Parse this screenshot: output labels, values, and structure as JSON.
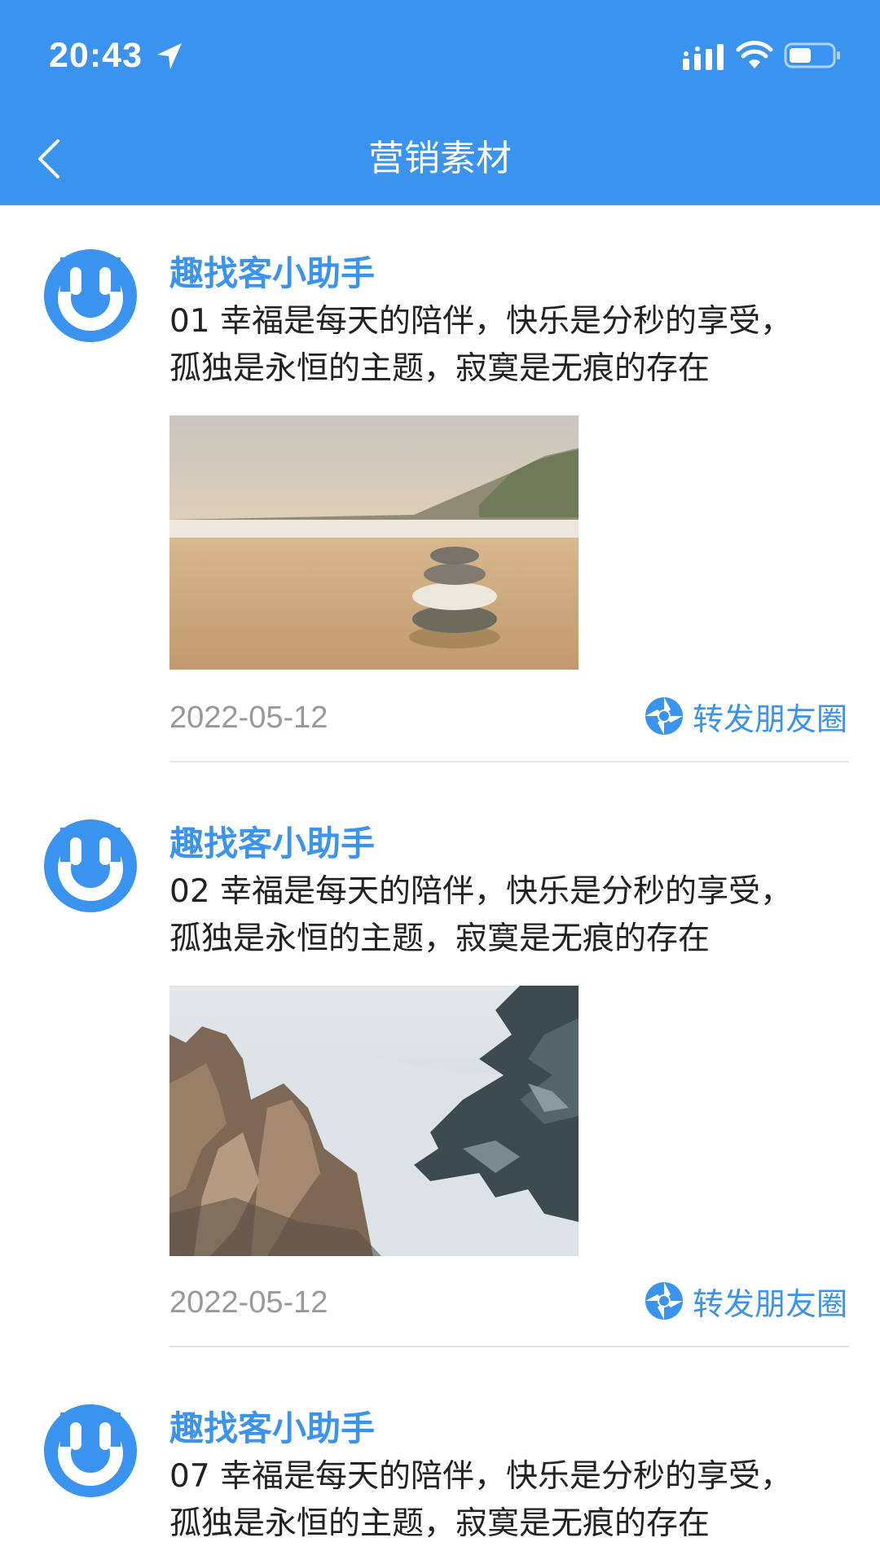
{
  "status_bar": {
    "time": "20:43"
  },
  "header": {
    "title": "营销素材",
    "back_icon": "chevron-left-icon"
  },
  "colors": {
    "brand": "#3a93ee",
    "date_gray": "#999999",
    "text": "#222222"
  },
  "posts": [
    {
      "author": "趣找客小助手",
      "lines": [
        "01 幸福是每天的陪伴，快乐是分秒的享受，",
        "孤独是永恒的主题，寂寞是无痕的存在"
      ],
      "image": "beach-stacked-stones-photo",
      "date": "2022-05-12",
      "share_label": "转发朋友圈",
      "share_icon": "aperture-icon"
    },
    {
      "author": "趣找客小助手",
      "lines": [
        "02 幸福是每天的陪伴，快乐是分秒的享受，",
        "孤独是永恒的主题，寂寞是无痕的存在"
      ],
      "image": "misty-mountain-pine-photo",
      "date": "2022-05-12",
      "share_label": "转发朋友圈",
      "share_icon": "aperture-icon"
    },
    {
      "author": "趣找客小助手",
      "lines": [
        "07 幸福是每天的陪伴，快乐是分秒的享受，",
        "孤独是永恒的主题，寂寞是无痕的存在"
      ]
    }
  ]
}
